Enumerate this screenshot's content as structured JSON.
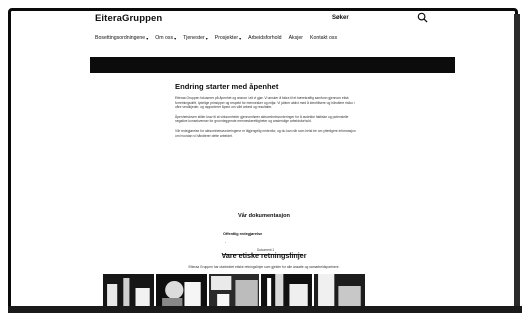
{
  "header": {
    "logo": "EiteraGruppen",
    "search_label": "Søker"
  },
  "nav": {
    "items": [
      {
        "label": "Bosettingsordningene",
        "chevron": true
      },
      {
        "label": "Om oss",
        "chevron": true
      },
      {
        "label": "Tjenester",
        "chevron": true
      },
      {
        "label": "Prosjekter",
        "chevron": true
      },
      {
        "label": "Arbeidsforhold",
        "chevron": false
      },
      {
        "label": "Aksjer",
        "chevron": false
      },
      {
        "label": "Kontakt oss",
        "chevron": false
      }
    ]
  },
  "article": {
    "title": "Endring starter med åpenhet",
    "paragraphs": [
      "Etteraa Gruppen fokuserer på åpenhet og ansvar i alt vi gjør. Vi ønsker å bidra til et bærekraftig samfunn gjennom etisk forretningsdrift, tydelige prinsipper og respekt for mennesker og miljø. Vi jobber aktivt med å identifisere og håndtere risiko i våre verdikjeder, og rapporterer åpent om vårt arbeid og resultater.",
      "Åpenhetsloven stiller krav til at virksomheter gjennomfører aktsomhetsvurderinger for å avdekke faktiske og potensielle negative konsekvenser for grunnleggende menneskerettigheter og anstendige arbeidsforhold.",
      "Vår redegjørelse for aktsomhetsvurderingene er tilgjengelig nedenfor, og du kan når som helst be om ytterligere informasjon om hvordan vi håndterer dette arbeidet."
    ]
  },
  "documentation": {
    "title": "Vår dokumentasjon",
    "subtitle": "Offentlig redegjørelse",
    "item_label": "Dokument 1"
  },
  "guidelines": {
    "title": "Vare etiske retningslinjer",
    "text": "Etteraa Gruppen har utarbeidet etiske retningslinjer som gjelder for alle ansatte og samarbeidspartnere."
  }
}
